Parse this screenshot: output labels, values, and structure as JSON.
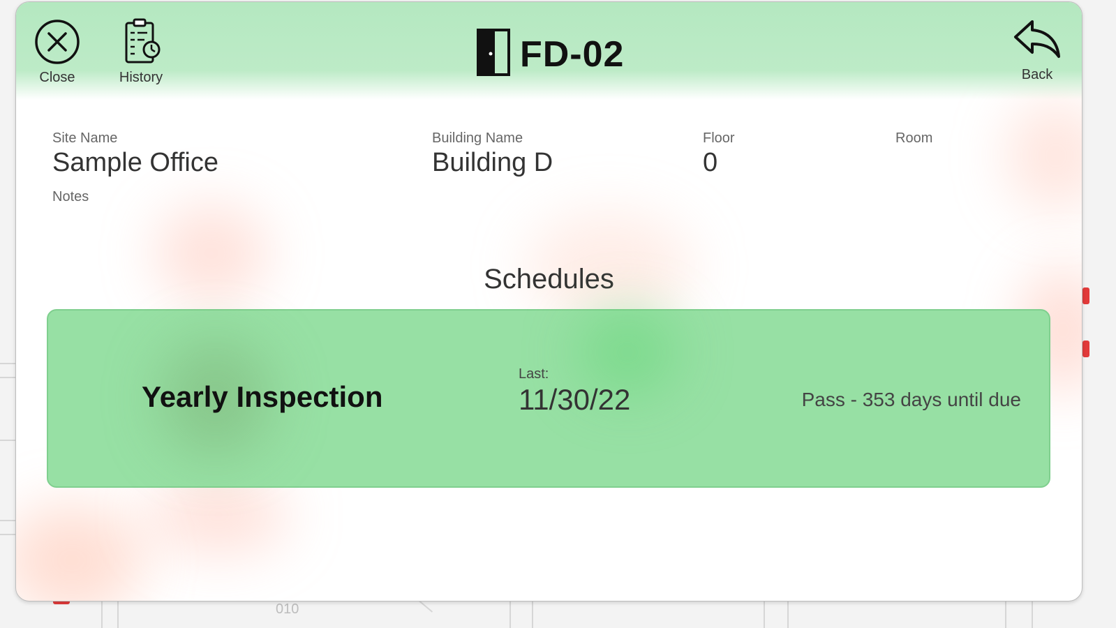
{
  "header": {
    "title": "FD-02",
    "close_label": "Close",
    "history_label": "History",
    "back_label": "Back"
  },
  "fields": {
    "site_name": {
      "label": "Site Name",
      "value": "Sample Office"
    },
    "building_name": {
      "label": "Building Name",
      "value": "Building D"
    },
    "floor": {
      "label": "Floor",
      "value": "0"
    },
    "room": {
      "label": "Room",
      "value": ""
    },
    "notes": {
      "label": "Notes",
      "value": ""
    }
  },
  "schedules": {
    "title": "Schedules",
    "items": [
      {
        "name": "Yearly Inspection",
        "last_label": "Last:",
        "last_date": "11/30/22",
        "status": "Pass - 353 days until due",
        "color": "#97e0a4"
      }
    ]
  },
  "background": {
    "plan_label": "010"
  },
  "colors": {
    "header_green": "#b4e8c0",
    "card_green": "#97e0a4",
    "alert_red": "#e23a3a"
  }
}
